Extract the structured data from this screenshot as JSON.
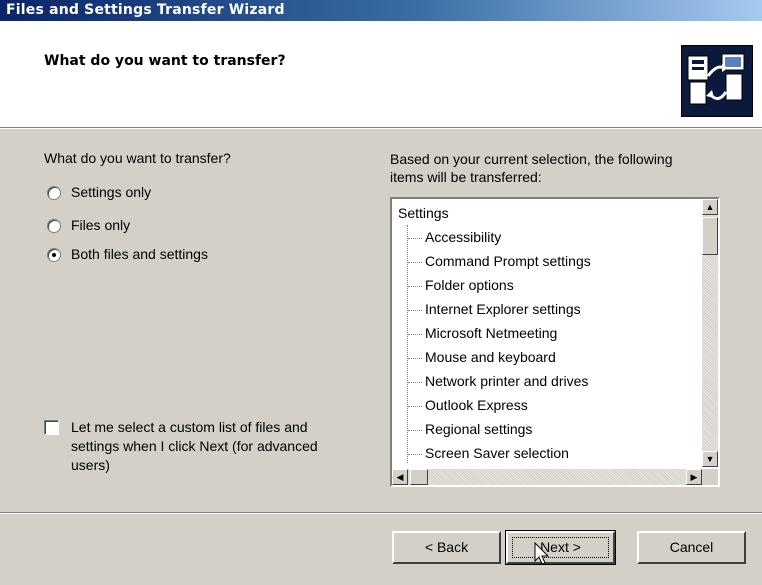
{
  "window": {
    "title": "Files and Settings Transfer Wizard"
  },
  "header": {
    "title": "What do you want to transfer?",
    "icon": "transfer-wizard-icon"
  },
  "left": {
    "question": "What do you want to transfer?",
    "options": [
      {
        "label": "Settings only",
        "selected": false
      },
      {
        "label": "Files only",
        "selected": false
      },
      {
        "label": "Both files and settings",
        "selected": true
      }
    ],
    "custom_list": {
      "label_lines": [
        "Let me select a custom list of files and",
        "settings when I click Next (for advanced",
        "users)"
      ],
      "checked": false
    }
  },
  "right": {
    "description_lines": [
      "Based on your current selection, the following",
      "items will be transferred:"
    ],
    "tree": {
      "root": "Settings",
      "items": [
        "Accessibility",
        "Command Prompt settings",
        "Folder options",
        "Internet Explorer settings",
        "Microsoft Netmeeting",
        "Mouse and keyboard",
        "Network printer and drives",
        "Outlook Express",
        "Regional settings",
        "Screen Saver selection"
      ]
    }
  },
  "buttons": {
    "back": "< Back",
    "next": "Next >",
    "cancel": "Cancel"
  }
}
